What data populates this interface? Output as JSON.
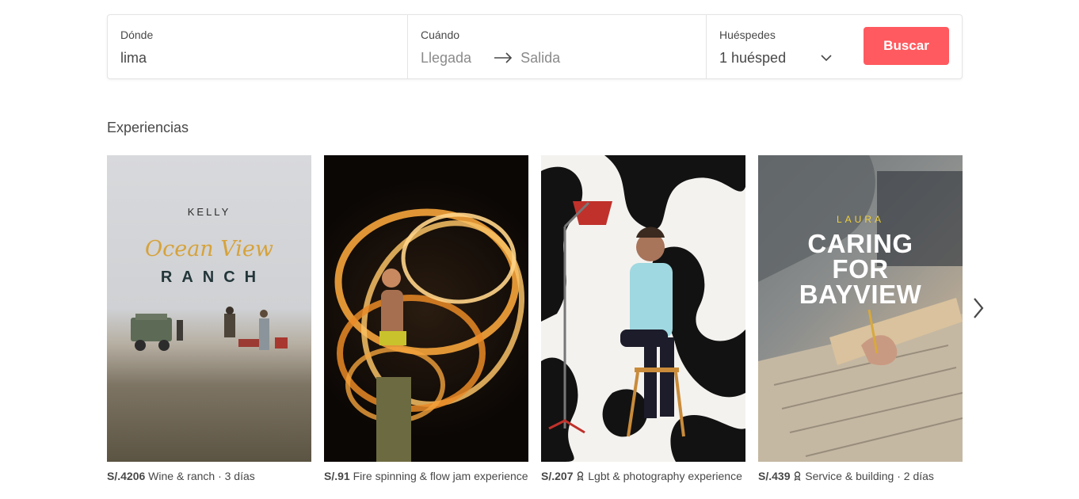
{
  "search": {
    "where_label": "Dónde",
    "where_value": "lima",
    "when_label": "Cuándo",
    "checkin_placeholder": "Llegada",
    "checkout_placeholder": "Salida",
    "guests_label": "Huéspedes",
    "guests_value": "1 huésped",
    "button_label": "Buscar"
  },
  "section_title": "Experiencias",
  "colors": {
    "accent": "#ff5a5f",
    "text": "#484848",
    "border": "#e4e4e4"
  },
  "cards": [
    {
      "price": "S/.4206",
      "description": "Wine & ranch · 3 días",
      "image_text": {
        "host": "KELLY",
        "script_title": "Ocean View",
        "title": "RANCH"
      }
    },
    {
      "price": "S/.91",
      "description": "Fire spinning & flow jam experience"
    },
    {
      "price": "S/.207",
      "badge_icon": "ribbon-icon",
      "description": "Lgbt & photography experience"
    },
    {
      "price": "S/.439",
      "badge_icon": "ribbon-icon",
      "description": "Service & building · 2 días",
      "image_text": {
        "host": "LAURA",
        "title_line1": "CARING",
        "title_line2": "FOR",
        "title_line3": "BAYVIEW"
      }
    }
  ],
  "next_icon": "chevron-right-icon"
}
